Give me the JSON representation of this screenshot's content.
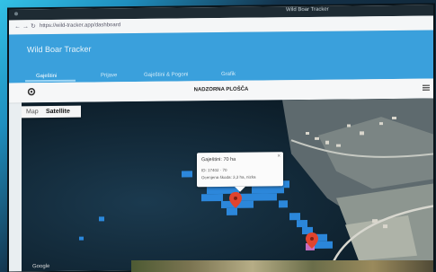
{
  "window": {
    "title": "Wild Boar Tracker"
  },
  "browser": {
    "url": "https://wild-tracker.app/dashboard",
    "back": "←",
    "forward": "→",
    "reload": "↻"
  },
  "app": {
    "title": "Wild Boar Tracker",
    "tabs": [
      "Gaještini",
      "Prijave",
      "Gaještini & Pogoni",
      "Grafik"
    ],
    "active_tab": 0
  },
  "toolbar": {
    "heading": "NADZORNA PLOŠČA"
  },
  "map": {
    "type_buttons": [
      "Map",
      "Satellite"
    ],
    "selected_type": "Satellite",
    "infowindow": {
      "title": "Gaještini: 70 ha",
      "lines": [
        "ID: 17402 · 70",
        "Ocenjena škoda: 3,3 ha, nizka"
      ],
      "close": "×"
    },
    "attribution": "Google",
    "colors": {
      "damage_cell": "#2e8fe8",
      "marker": "#e0442e",
      "pink_cell": "#d071c9"
    }
  }
}
